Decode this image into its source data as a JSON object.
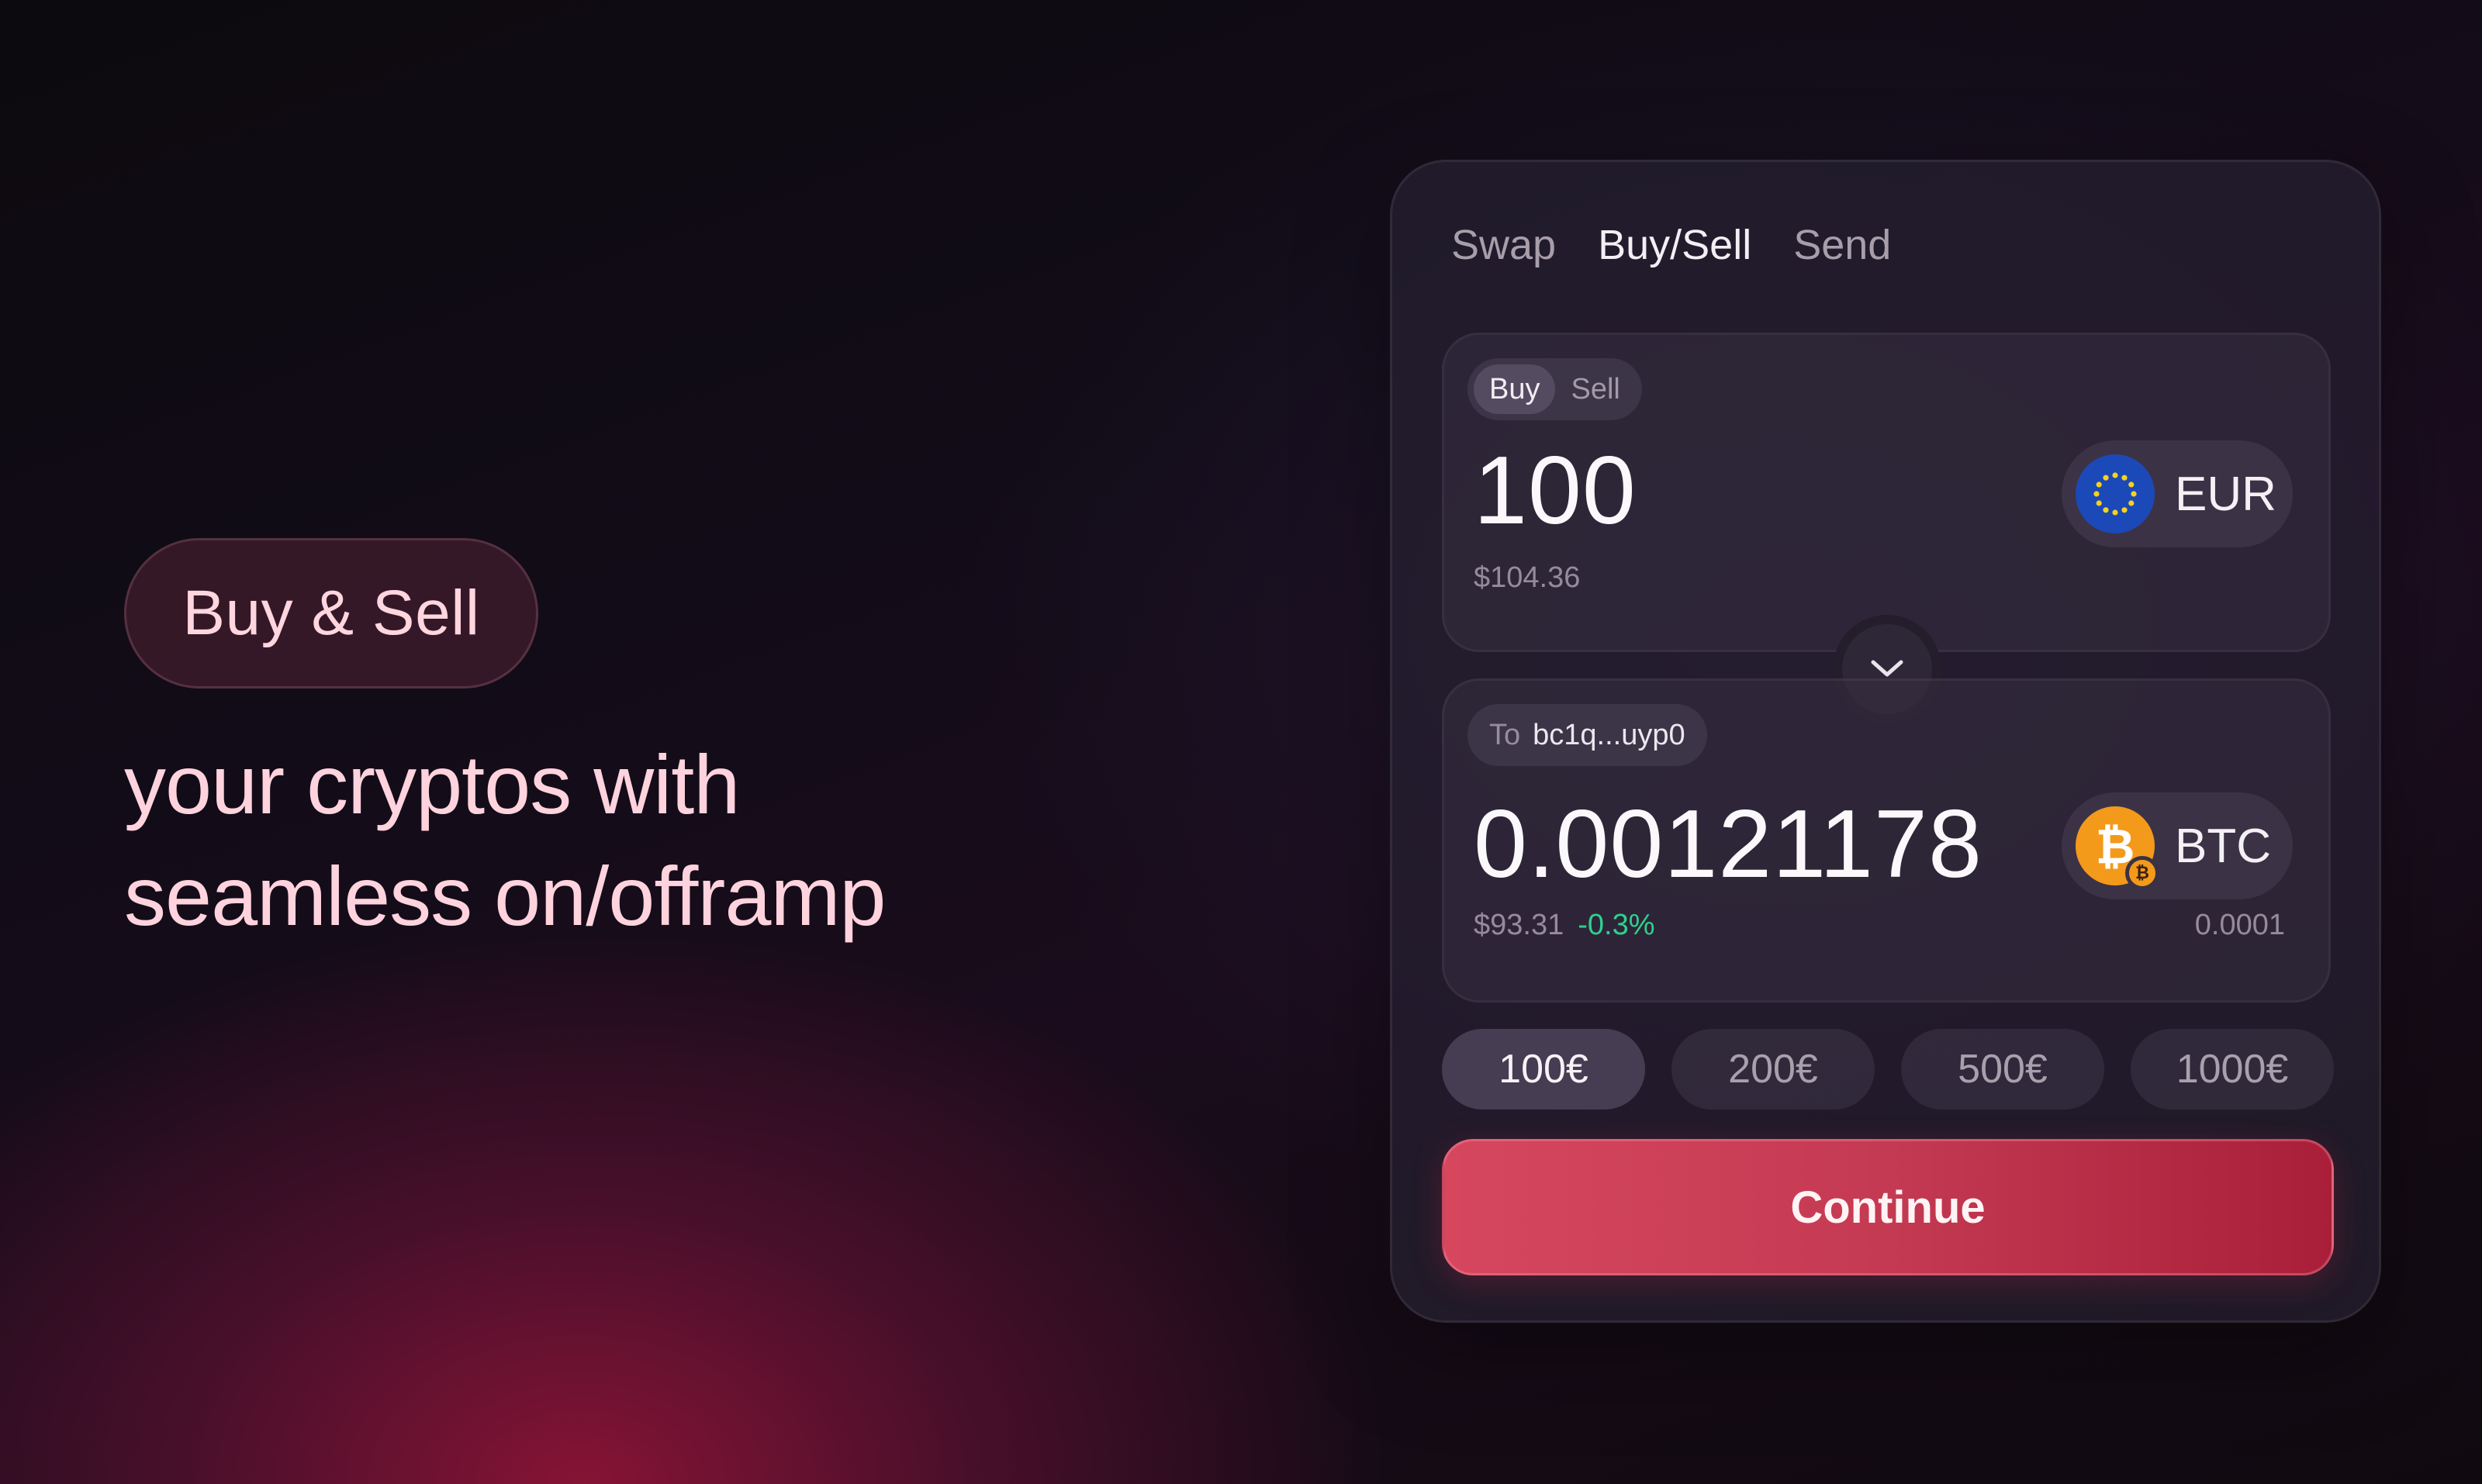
{
  "hero": {
    "badge": "Buy & Sell",
    "line1": "your cryptos with",
    "line2": "seamless on/offramp"
  },
  "widget": {
    "tabs": [
      "Swap",
      "Buy/Sell",
      "Send"
    ],
    "active_tab": "Buy/Sell",
    "mode": {
      "buy": "Buy",
      "sell": "Sell",
      "active": "Buy"
    },
    "from": {
      "amount": "100",
      "fiat_value": "$104.36",
      "currency": "EUR",
      "icon": "eu-flag-icon"
    },
    "switch_icon": "chevron-down-icon",
    "to": {
      "label": "To",
      "address": "bc1q...uyp0",
      "amount": "0.00121178",
      "fiat_value": "$93.31",
      "change": "-0.3%",
      "fee": "0.0001",
      "currency": "BTC",
      "icon": "bitcoin-icon"
    },
    "presets": [
      "100€",
      "200€",
      "500€",
      "1000€"
    ],
    "active_preset": "100€",
    "continue_label": "Continue"
  },
  "colors": {
    "accent": "#d6475e",
    "positive_change": "#2fd08f",
    "eur_blue": "#1b49b8",
    "btc_orange": "#f39a1b"
  }
}
